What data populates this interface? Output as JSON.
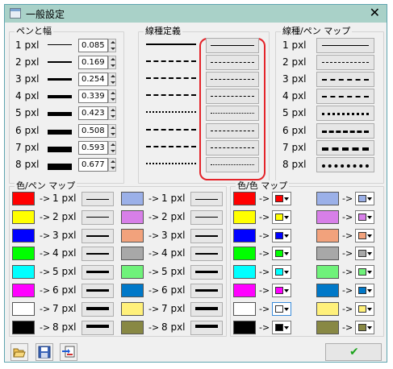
{
  "window": {
    "title": "一般設定",
    "close_glyph": "✕"
  },
  "pen_width": {
    "label": "ペンと幅",
    "rows": [
      {
        "label": "1 pxl",
        "value": "0.085"
      },
      {
        "label": "2 pxl",
        "value": "0.169"
      },
      {
        "label": "3 pxl",
        "value": "0.254"
      },
      {
        "label": "4 pxl",
        "value": "0.339"
      },
      {
        "label": "5 pxl",
        "value": "0.423"
      },
      {
        "label": "6 pxl",
        "value": "0.508"
      },
      {
        "label": "7 pxl",
        "value": "0.593"
      },
      {
        "label": "8 pxl",
        "value": "0.677"
      }
    ]
  },
  "line_types": {
    "label": "線種定義",
    "patterns": [
      "solid",
      "dash",
      "dash-dot",
      "dash-dot-dot",
      "dot",
      "long-dash",
      "short-dash",
      "sparse-dash"
    ]
  },
  "line_pen_map": {
    "label": "線種/ペン マップ",
    "rows": [
      {
        "label": "1 pxl",
        "pattern": "solid"
      },
      {
        "label": "2 pxl",
        "pattern": "dash"
      },
      {
        "label": "3 pxl",
        "pattern": "dash-dot"
      },
      {
        "label": "4 pxl",
        "pattern": "dash-dot-dot"
      },
      {
        "label": "5 pxl",
        "pattern": "dot"
      },
      {
        "label": "6 pxl",
        "pattern": "long-dash"
      },
      {
        "label": "7 pxl",
        "pattern": "short-dash"
      },
      {
        "label": "8 pxl",
        "pattern": "sparse-dash"
      }
    ]
  },
  "color_pen_map": {
    "label": "色/ペン マップ",
    "left": [
      {
        "color": "#ff0000",
        "arrow": "->",
        "label": "1 pxl"
      },
      {
        "color": "#ffff00",
        "arrow": "->",
        "label": "2 pxl"
      },
      {
        "color": "#0000ff",
        "arrow": "->",
        "label": "3 pxl"
      },
      {
        "color": "#00ff00",
        "arrow": "->",
        "label": "4 pxl"
      },
      {
        "color": "#00ffff",
        "arrow": "->",
        "label": "5 pxl"
      },
      {
        "color": "#ff00ff",
        "arrow": "->",
        "label": "6 pxl"
      },
      {
        "color": "#ffffff",
        "arrow": "->",
        "label": "7 pxl"
      },
      {
        "color": "#000000",
        "arrow": "->",
        "label": "8 pxl"
      }
    ],
    "right": [
      {
        "color": "#9bb0e8",
        "arrow": "->",
        "label": "1 pxl"
      },
      {
        "color": "#d77fe8",
        "arrow": "->",
        "label": "2 pxl"
      },
      {
        "color": "#f2a27c",
        "arrow": "->",
        "label": "3 pxl"
      },
      {
        "color": "#a8a8a8",
        "arrow": "->",
        "label": "4 pxl"
      },
      {
        "color": "#6ff27a",
        "arrow": "->",
        "label": "5 pxl"
      },
      {
        "color": "#0078c8",
        "arrow": "->",
        "label": "6 pxl"
      },
      {
        "color": "#fff07a",
        "arrow": "->",
        "label": "7 pxl"
      },
      {
        "color": "#888844",
        "arrow": "->",
        "label": "8 pxl"
      }
    ]
  },
  "color_color_map": {
    "label": "色/色 マップ",
    "left": [
      {
        "from": "#ff0000",
        "arrow": "->",
        "to": "#ff0000"
      },
      {
        "from": "#ffff00",
        "arrow": "->",
        "to": "#ffff00"
      },
      {
        "from": "#0000ff",
        "arrow": "->",
        "to": "#0000ff"
      },
      {
        "from": "#00ff00",
        "arrow": "->",
        "to": "#00ff00"
      },
      {
        "from": "#00ffff",
        "arrow": "->",
        "to": "#00ffff"
      },
      {
        "from": "#ff00ff",
        "arrow": "->",
        "to": "#ff00ff"
      },
      {
        "from": "#ffffff",
        "arrow": "->",
        "to": "#ffffff"
      },
      {
        "from": "#000000",
        "arrow": "->",
        "to": "#000000"
      }
    ],
    "right": [
      {
        "from": "#9bb0e8",
        "arrow": "->",
        "to": "#9bb0e8"
      },
      {
        "from": "#d77fe8",
        "arrow": "->",
        "to": "#d77fe8"
      },
      {
        "from": "#f2a27c",
        "arrow": "->",
        "to": "#f2a27c"
      },
      {
        "from": "#a8a8a8",
        "arrow": "->",
        "to": "#a8a8a8"
      },
      {
        "from": "#6ff27a",
        "arrow": "->",
        "to": "#6ff27a"
      },
      {
        "from": "#0078c8",
        "arrow": "->",
        "to": "#0078c8"
      },
      {
        "from": "#fff07a",
        "arrow": "->",
        "to": "#fff07a"
      },
      {
        "from": "#888844",
        "arrow": "->",
        "to": "#888844"
      }
    ]
  },
  "toolbar": {
    "icons": [
      "open-folder-icon",
      "save-disk-icon",
      "import-arrows-icon"
    ],
    "ok_glyph": "✔",
    "ok_color": "#1aa31a"
  },
  "colors": {
    "titlebar": "#a9d1c8",
    "highlight": "#e4242a"
  }
}
